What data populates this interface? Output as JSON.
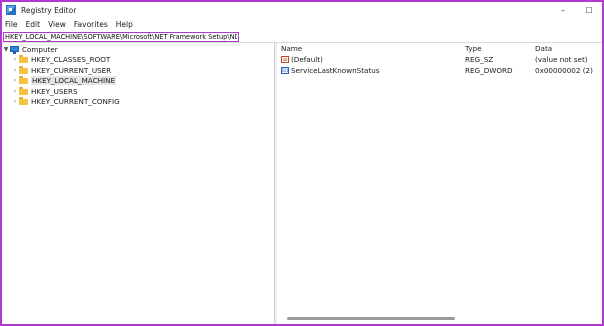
{
  "window": {
    "title": "Registry Editor",
    "minimize_glyph": "–",
    "maximize_glyph": "☐"
  },
  "menu": [
    "File",
    "Edit",
    "View",
    "Favorites",
    "Help"
  ],
  "address": {
    "value": "HKEY_LOCAL_MACHINE\\SOFTWARE\\Microsoft\\NET Framework Setup\\NDP"
  },
  "tree": {
    "root": {
      "label": "Computer",
      "expanded": true,
      "icon": "computer-icon"
    },
    "children": [
      {
        "label": "HKEY_CLASSES_ROOT",
        "selected": false
      },
      {
        "label": "HKEY_CURRENT_USER",
        "selected": false
      },
      {
        "label": "HKEY_LOCAL_MACHINE",
        "selected": true
      },
      {
        "label": "HKEY_USERS",
        "selected": false
      },
      {
        "label": "HKEY_CURRENT_CONFIG",
        "selected": false
      }
    ]
  },
  "values_list": {
    "columns": {
      "name": "Name",
      "type": "Type",
      "data": "Data"
    },
    "rows": [
      {
        "icon": "ab",
        "name": "(Default)",
        "type": "REG_SZ",
        "data": "(value not set)"
      },
      {
        "icon": "011",
        "name": "ServiceLastKnownStatus",
        "type": "REG_DWORD",
        "data": "0x00000002 (2)"
      }
    ]
  },
  "colors": {
    "highlight_border": "#b03ad0",
    "folder": "#f4c33f",
    "selection": "#e5e5e5"
  }
}
